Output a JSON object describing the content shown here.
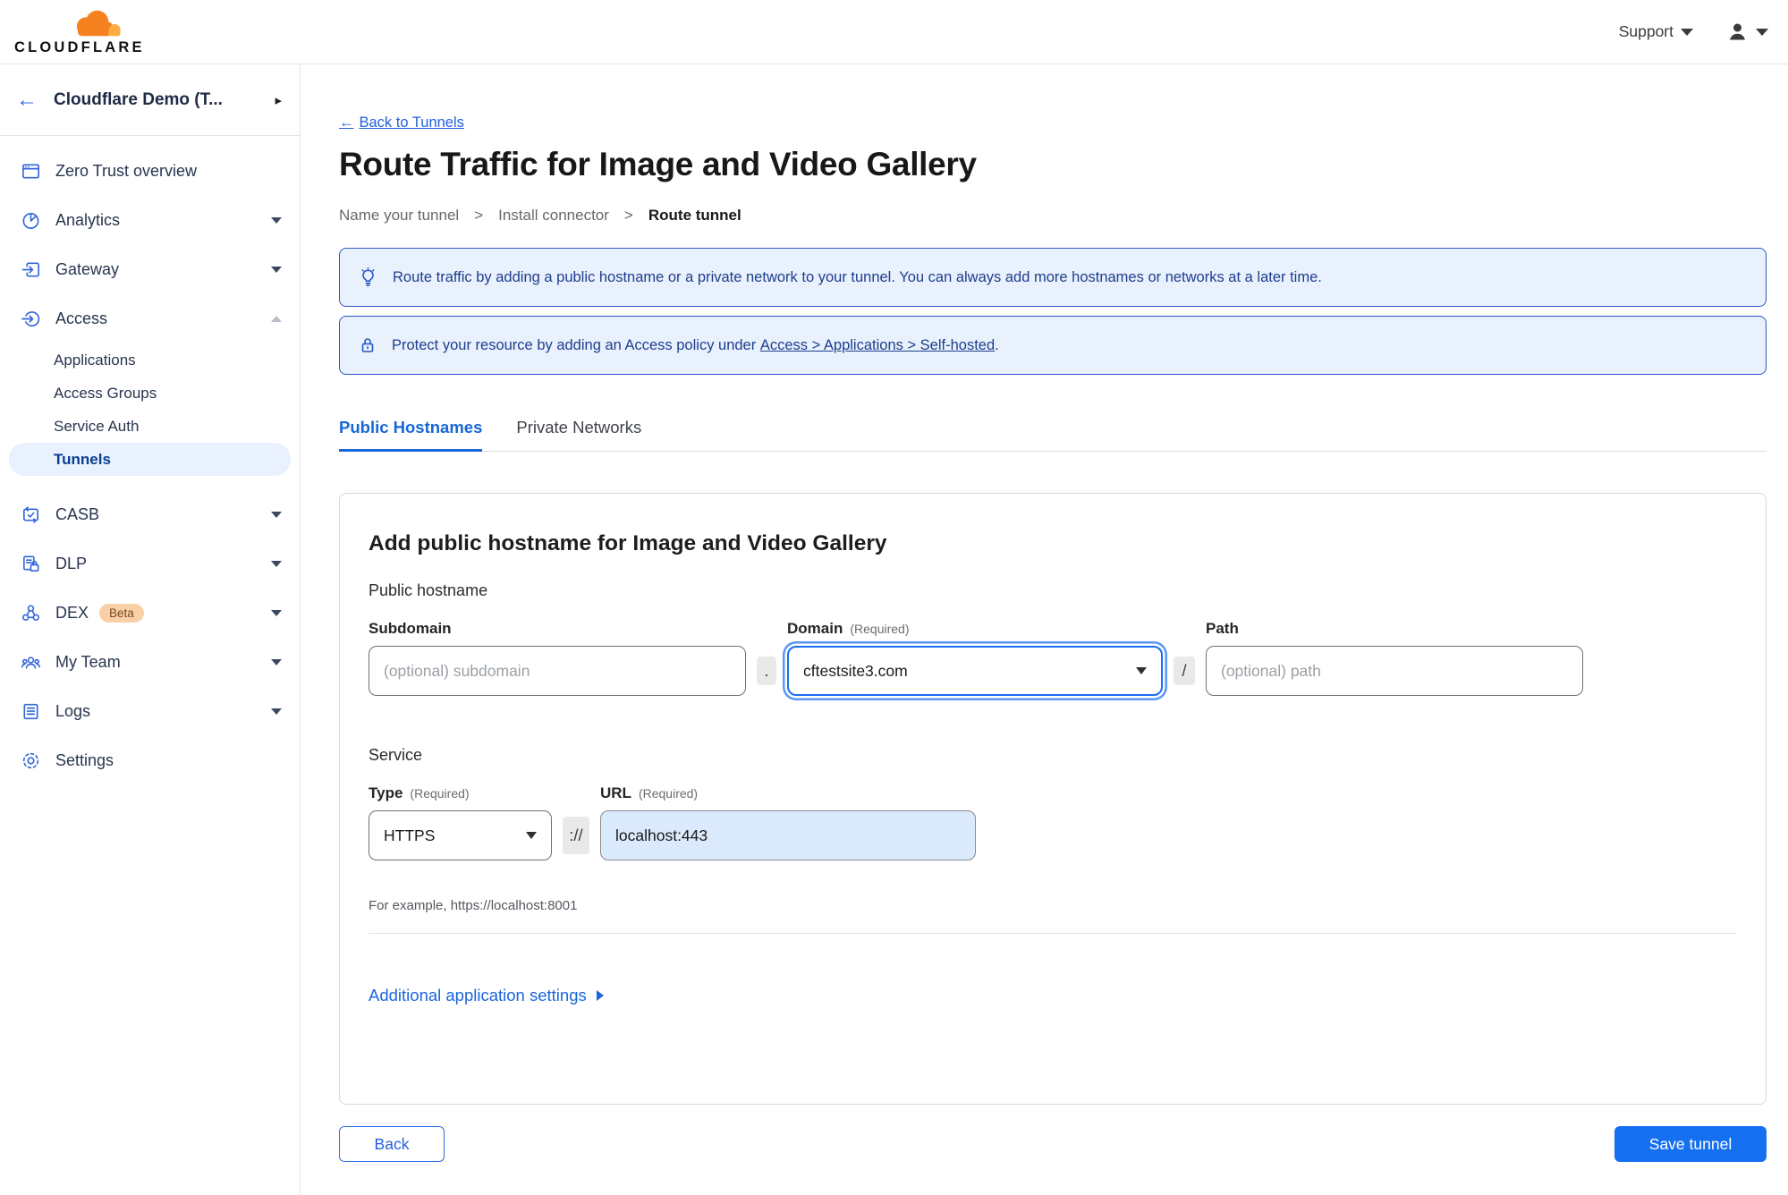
{
  "header": {
    "logo_text": "CLOUDFLARE",
    "support_label": "Support"
  },
  "icons": {
    "back_arrow": "←",
    "header_chevron": "▸",
    "link_arrow": "←"
  },
  "sidebar": {
    "account_name": "Cloudflare Demo (T...",
    "items": [
      {
        "label": "Zero Trust overview"
      },
      {
        "label": "Analytics"
      },
      {
        "label": "Gateway"
      },
      {
        "label": "Access"
      },
      {
        "label": "CASB"
      },
      {
        "label": "DLP"
      },
      {
        "label": "DEX",
        "badge": "Beta"
      },
      {
        "label": "My Team"
      },
      {
        "label": "Logs"
      },
      {
        "label": "Settings"
      }
    ],
    "access_sub_items": [
      {
        "label": "Applications"
      },
      {
        "label": "Access Groups"
      },
      {
        "label": "Service Auth"
      },
      {
        "label": "Tunnels",
        "selected": true
      }
    ]
  },
  "main": {
    "back_link_label": "Back to Tunnels",
    "page_title": "Route Traffic for Image and Video Gallery",
    "step_separator": ">",
    "steps": [
      {
        "label": "Name your tunnel"
      },
      {
        "label": "Install connector"
      },
      {
        "label": "Route tunnel",
        "current": true
      }
    ],
    "banners": [
      {
        "icon": "lightbulb-icon",
        "text": "Route traffic by adding a public hostname or a private network to your tunnel. You can always add more hostnames or networks at a later time."
      },
      {
        "icon": "lock-icon",
        "text_prefix": "Protect your resource by adding an Access policy under",
        "link_text": "Access > Applications > Self-hosted",
        "text_suffix": "."
      }
    ],
    "tabs": [
      {
        "label": "Public Hostnames",
        "active": true
      },
      {
        "label": "Private Networks",
        "active": false
      }
    ],
    "form": {
      "heading": "Add public hostname for Image and Video Gallery",
      "public_hostname_label": "Public hostname",
      "required_note": "(Required)",
      "subdomain_label": "Subdomain",
      "subdomain_placeholder": "(optional) subdomain",
      "dot_separator": ".",
      "domain_label": "Domain",
      "domain_value": "cftestsite3.com",
      "slash_separator": "/",
      "path_label": "Path",
      "path_placeholder": "(optional) path",
      "service_label": "Service",
      "type_label": "Type",
      "type_value": "HTTPS",
      "scheme_separator": "://",
      "url_label": "URL",
      "url_value": "localhost:443",
      "url_hint": "For example, https://localhost:8001",
      "additional_settings_label": "Additional application settings"
    },
    "footer": {
      "back_label": "Back",
      "save_label": "Save tunnel"
    }
  },
  "colors": {
    "accent_blue": "#1a66dd",
    "save_button_blue": "#1470f0",
    "banner_bg": "#e9f1fc",
    "banner_border": "#2d56c3",
    "banner_text": "#1e3e8e",
    "selected_pill_bg": "#e8f1fd",
    "selected_text": "#0b3d91",
    "logo_orange": "#f6821f",
    "logo_orange_light": "#fbad41",
    "beta_badge_bg": "#f8d0a8",
    "beta_badge_text": "#7c4a1e"
  }
}
